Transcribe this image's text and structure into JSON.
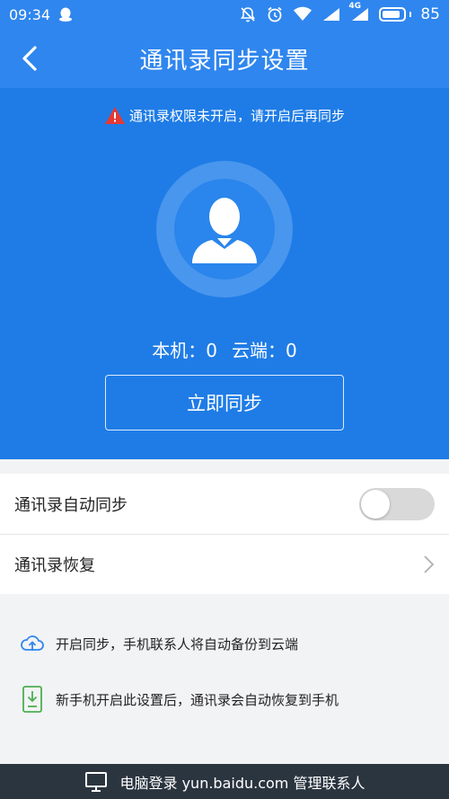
{
  "status_bar": {
    "time": "09:34",
    "battery_level": "85",
    "network_label": "4G",
    "battery_fraction": 0.85,
    "icons": [
      "qq-icon",
      "bell-off-icon",
      "alarm-icon",
      "wifi-icon",
      "signal-icon",
      "signal-4g-icon",
      "battery-icon"
    ]
  },
  "header": {
    "title": "通讯录同步设置",
    "back_icon": "chevron-left-icon"
  },
  "hero": {
    "warning_text": "通讯录权限未开启，请开启后再同步",
    "local_count": "本机：0",
    "cloud_count": "云端：0",
    "sync_button_label": "立即同步",
    "avatar_icon": "person-icon"
  },
  "settings": {
    "auto_sync_label": "通讯录自动同步",
    "auto_sync_enabled": false,
    "restore_label": "通讯录恢复"
  },
  "info": {
    "cloud_backup_text": "开启同步，手机联系人将自动备份到云端",
    "new_phone_text": "新手机开启此设置后，通讯录会自动恢复到手机"
  },
  "footer": {
    "text": "电脑登录 yun.baidu.com 管理联系人",
    "icon": "monitor-icon"
  },
  "colors": {
    "primary": "#2f86ee",
    "hero": "#1f7ce6",
    "warning": "#e53935",
    "accent_green": "#4caf50",
    "footer": "#2b3540"
  }
}
